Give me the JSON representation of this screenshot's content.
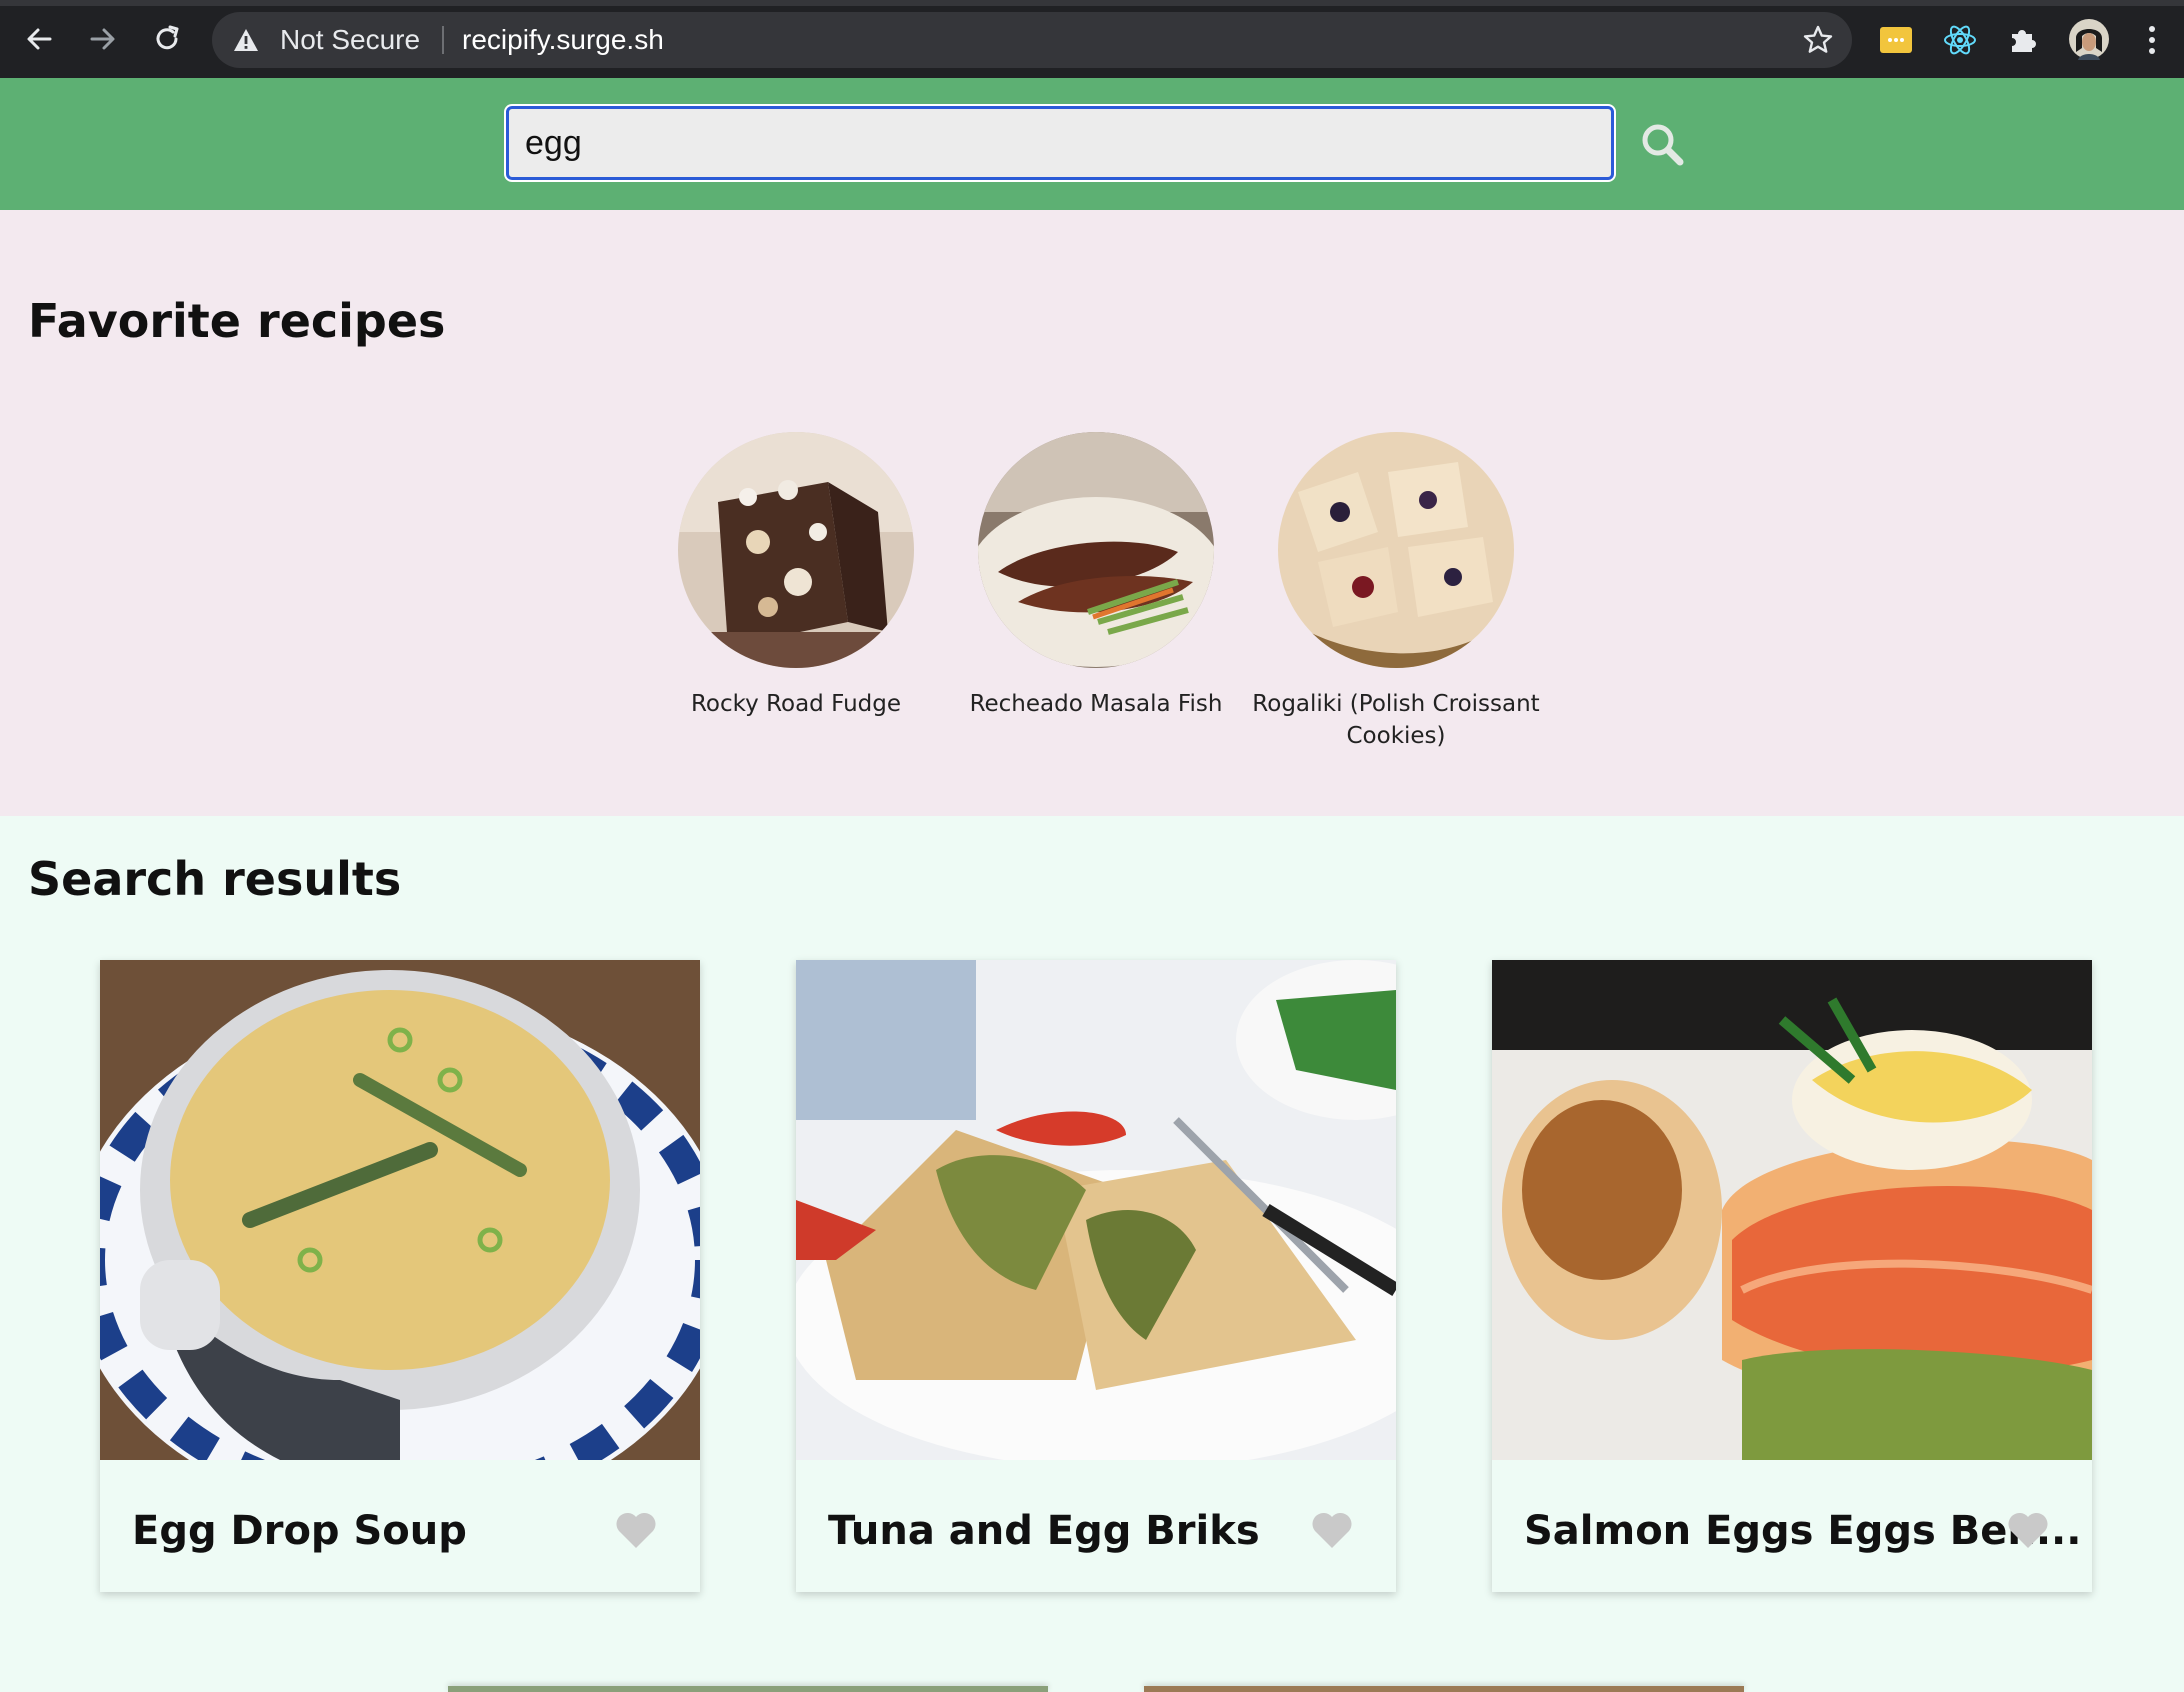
{
  "browser": {
    "security_label": "Not Secure",
    "url": "recipify.surge.sh"
  },
  "search": {
    "value": "egg"
  },
  "favorites": {
    "title": "Favorite recipes",
    "items": [
      {
        "name": "Rocky Road Fudge"
      },
      {
        "name": "Recheado Masala Fish"
      },
      {
        "name": "Rogaliki (Polish Croissant Cookies)"
      }
    ]
  },
  "results": {
    "title": "Search results",
    "cards": [
      {
        "name": "Egg Drop Soup"
      },
      {
        "name": "Tuna and Egg Briks"
      },
      {
        "name": "Salmon Eggs Eggs Ben..."
      }
    ]
  },
  "colors": {
    "header_green": "#5db073",
    "favorites_bg": "#f3e9ef",
    "results_bg": "#eefbf5",
    "heart_gray": "#c9c9c9"
  }
}
